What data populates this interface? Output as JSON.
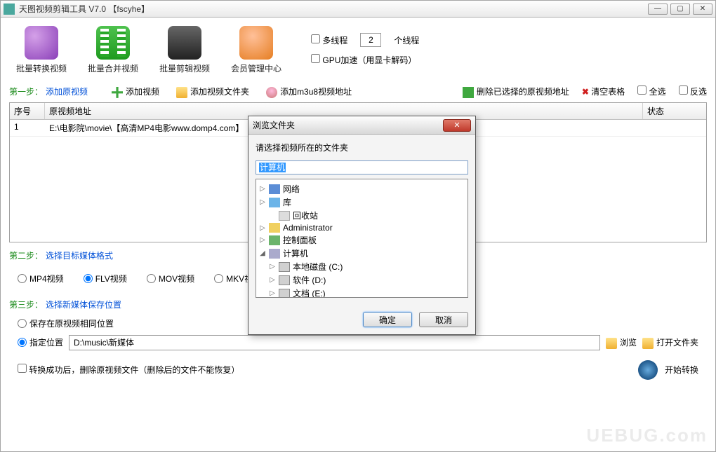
{
  "titlebar": {
    "title": "天图视频剪辑工具 V7.0   【fscyhe】"
  },
  "toolbar": {
    "convert": "批量转换视频",
    "merge": "批量合并视频",
    "edit": "批量剪辑视频",
    "member": "会员管理中心"
  },
  "checkboxes": {
    "multithread": "多线程",
    "thread_count": "2",
    "thread_suffix": "个线程",
    "gpu": "GPU加速（用显卡解码）"
  },
  "step1": {
    "green": "第一步：",
    "blue": "添加原视频",
    "add_video": "添加视频",
    "add_folder": "添加视频文件夹",
    "add_m3u8": "添加m3u8视频地址",
    "del_selected": "删除已选择的原视频地址",
    "clear": "清空表格",
    "select_all": "全选",
    "invert": "反选"
  },
  "table": {
    "col_seq": "序号",
    "col_path": "原视频地址",
    "col_status": "状态",
    "rows": [
      {
        "seq": "1",
        "path": "E:\\电影院\\movie\\【高清MP4电影www.domp4.com】",
        "status": ""
      }
    ]
  },
  "step2": {
    "green": "第二步：",
    "blue": "选择目标媒体格式",
    "mp4": "MP4视频",
    "flv": "FLV视频",
    "mov": "MOV视频",
    "mkv": "MKV视频"
  },
  "step3": {
    "green": "第三步：",
    "blue": "选择新媒体保存位置",
    "same_loc": "保存在原视频相同位置",
    "custom_loc": "指定位置",
    "path": "D:\\music\\新媒体",
    "browse": "浏览",
    "open_folder": "打开文件夹"
  },
  "delete_after": "转换成功后，删除原视频文件（删除后的文件不能恢复）",
  "start": "开始转换",
  "dialog": {
    "title": "浏览文件夹",
    "label": "请选择视频所在的文件夹",
    "input": "计算机",
    "ok": "确定",
    "cancel": "取消",
    "tree": {
      "network": "网络",
      "library": "库",
      "recycle": "回收站",
      "admin": "Administrator",
      "panel": "控制面板",
      "computer": "计算机",
      "disk_c": "本地磁盘 (C:)",
      "disk_d": "软件 (D:)",
      "disk_e": "文档 (E:)"
    }
  },
  "watermark": "UEBUG.com"
}
